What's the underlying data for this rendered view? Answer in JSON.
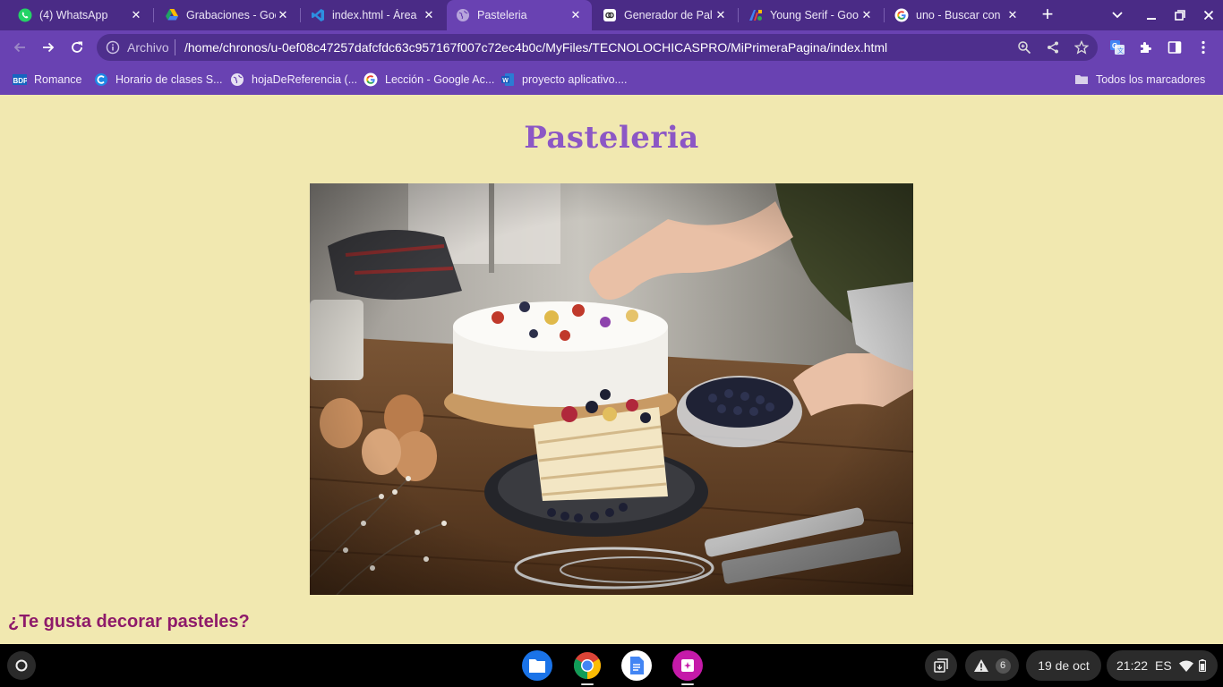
{
  "browser": {
    "tabs": [
      {
        "title": "(4) WhatsApp",
        "icon": "whatsapp-icon",
        "active": false
      },
      {
        "title": "Grabaciones - Goo",
        "icon": "google-drive-icon",
        "active": false
      },
      {
        "title": "index.html - Área",
        "icon": "vscode-icon",
        "active": false
      },
      {
        "title": "Pasteleria",
        "icon": "globe-icon",
        "active": true
      },
      {
        "title": "Generador de Pal",
        "icon": "generator-icon",
        "active": false
      },
      {
        "title": "Young Serif - Goo",
        "icon": "google-fonts-icon",
        "active": false
      },
      {
        "title": "uno - Buscar con",
        "icon": "google-icon",
        "active": false
      }
    ],
    "omnibox": {
      "scheme_label": "Archivo",
      "url": "/home/chronos/u-0ef08c47257dafcfdc63c957167f007c72ec4b0c/MyFiles/TECNOLOCHICASPRO/MiPrimeraPagina/index.html"
    },
    "bookmarks": [
      {
        "label": "Romance",
        "icon": "bdp-icon"
      },
      {
        "label": "Horario de clases S...",
        "icon": "classroom-icon"
      },
      {
        "label": "hojaDeReferencia (...",
        "icon": "globe-icon"
      },
      {
        "label": "Lección - Google Ac...",
        "icon": "google-icon"
      },
      {
        "label": "proyecto aplicativo....",
        "icon": "word-icon"
      }
    ],
    "bookmarks_folder": "Todos los marcadores"
  },
  "page": {
    "title": "Pasteleria",
    "hero_image": "cake-decorating-photo",
    "subheading": "¿Te gusta decorar pasteles?"
  },
  "shelf": {
    "apps": [
      "files-icon",
      "chrome-icon",
      "docs-icon",
      "screencast-icon"
    ],
    "notification_count": "6",
    "date": "19 de oct",
    "time": "21:22",
    "ime": "ES"
  },
  "colors": {
    "tabbar": "#4a2b86",
    "toolbar": "#6942b2",
    "page_bg": "#f1e8b0",
    "title": "#8c57c5",
    "subheading": "#8e1a6a"
  }
}
